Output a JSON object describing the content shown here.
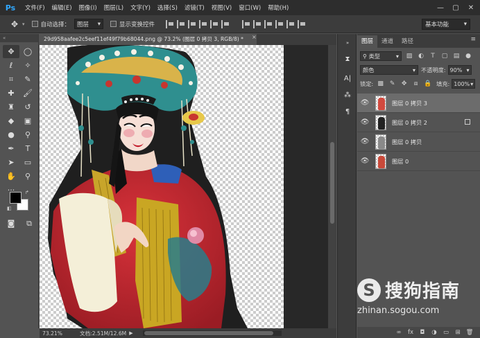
{
  "app": {
    "logo": "Ps",
    "menus": [
      "文件(F)",
      "编辑(E)",
      "图像(I)",
      "图层(L)",
      "文字(Y)",
      "选择(S)",
      "滤镜(T)",
      "视图(V)",
      "窗口(W)",
      "帮助(H)"
    ],
    "window_controls": [
      "—",
      "▢",
      "✕"
    ]
  },
  "options_bar": {
    "auto_select_label": "自动选择：",
    "auto_select_value": "图层",
    "show_transform_label": "显示变换控件",
    "workspace": "基本功能"
  },
  "document": {
    "tab_title": "29d958aafee2c5eef11ef49f79b68044.png @ 73.2% (图层 0 拷贝 3, RGB/8) *",
    "close": "×"
  },
  "status": {
    "zoom": "73.21%",
    "doc_size": "文档:2.51M/12.6M",
    "arrow": "▶"
  },
  "layers_panel": {
    "tabs": [
      "图层",
      "通道",
      "路径"
    ],
    "menu_icon": "≡",
    "filter_kind": "类型",
    "blend_mode": "颜色",
    "opacity_label": "不透明度:",
    "opacity_value": "90%",
    "lock_label": "锁定:",
    "fill_label": "填充:",
    "fill_value": "100%",
    "layers": [
      {
        "name": "图层 0 拷贝 3",
        "selected": true,
        "visible": true,
        "has_mask_icon": false
      },
      {
        "name": "图层 0 拷贝 2",
        "selected": false,
        "visible": true,
        "has_mask_icon": true
      },
      {
        "name": "图层 0 拷贝",
        "selected": false,
        "visible": true,
        "has_mask_icon": false
      },
      {
        "name": "图层 0",
        "selected": false,
        "visible": true,
        "has_mask_icon": false
      }
    ],
    "bottom_icons": [
      "link-icon",
      "fx-icon",
      "mask-icon",
      "adjustment-icon",
      "folder-icon",
      "new-layer-icon",
      "trash-icon"
    ],
    "bottom_glyphs": [
      "∞",
      "fx",
      "◘",
      "◑",
      "▭",
      "⊞",
      "🗑"
    ]
  },
  "watermark": {
    "symbol": "S",
    "brand": "搜狗指南",
    "url": "zhinan.sogou.com"
  },
  "colors": {
    "accent_ps": "#31a8ff",
    "panel_bg": "#535353",
    "dark_bar": "#2d2d2d",
    "selected_layer": "#6c6c6c"
  }
}
